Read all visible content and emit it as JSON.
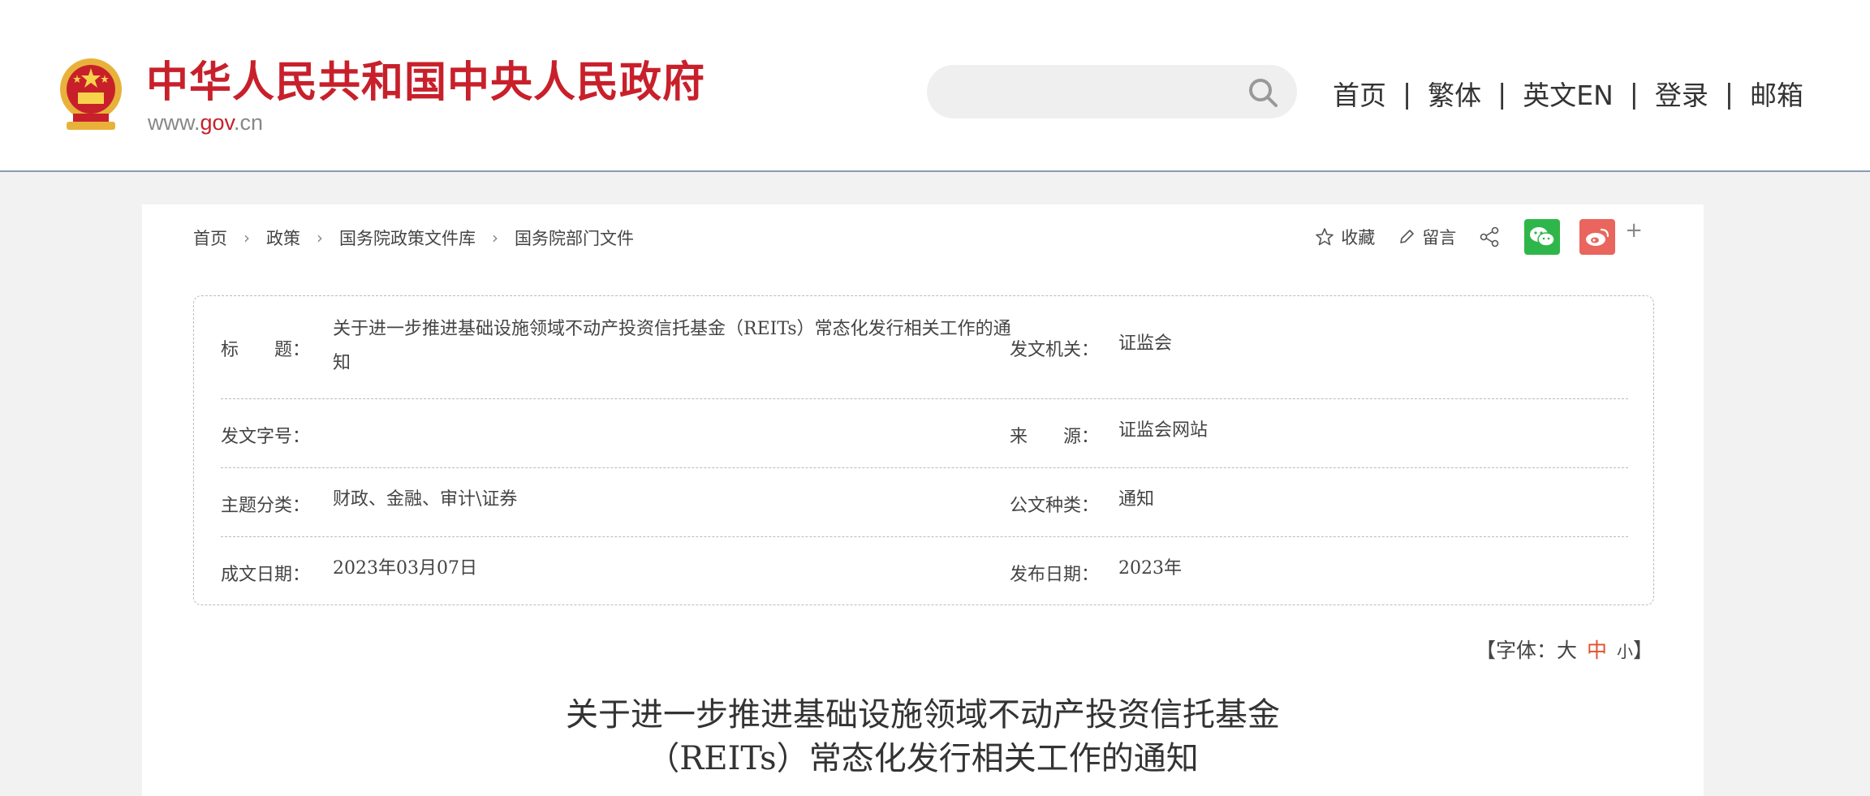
{
  "header": {
    "site_title": "中华人民共和国中央人民政府",
    "site_url_prefix": "www.",
    "site_url_gov": "gov",
    "site_url_suffix": ".cn",
    "search": {
      "placeholder": "",
      "icon": "search-icon"
    },
    "nav": [
      "首页",
      "繁体",
      "英文EN",
      "登录",
      "邮箱"
    ],
    "nav_separator": "|"
  },
  "breadcrumb": [
    "首页",
    "政策",
    "国务院政策文件库",
    "国务院部门文件"
  ],
  "actions": {
    "favorite_label": "收藏",
    "comment_label": "留言",
    "plus": "+"
  },
  "info": {
    "title_label": "标　　题：",
    "title_value": "关于进一步推进基础设施领域不动产投资信托基金（REITs）常态化发行相关工作的通知",
    "issuer_label": "发文机关：",
    "issuer_value": "证监会",
    "doc_number_label": "发文字号：",
    "doc_number_value": "",
    "source_label": "来　　源：",
    "source_value": "证监会网站",
    "category_label": "主题分类：",
    "category_value": "财政、金融、审计\\证券",
    "doc_type_label": "公文种类：",
    "doc_type_value": "通知",
    "written_date_label": "成文日期：",
    "written_date_value": "2023年03月07日",
    "publish_date_label": "发布日期：",
    "publish_date_value": "2023年"
  },
  "font_size": {
    "open": "【字体：",
    "large": "大",
    "medium": "中",
    "small": "小",
    "close": "】",
    "active_color": "#e0522c"
  },
  "document": {
    "title_line1": "关于进一步推进基础设施领域不动产投资信托基金",
    "title_line2": "（REITs）常态化发行相关工作的通知"
  },
  "colors": {
    "brand_red": "#c8202b",
    "wechat_green": "#2fb64a",
    "weibo_red": "#e9655d"
  }
}
